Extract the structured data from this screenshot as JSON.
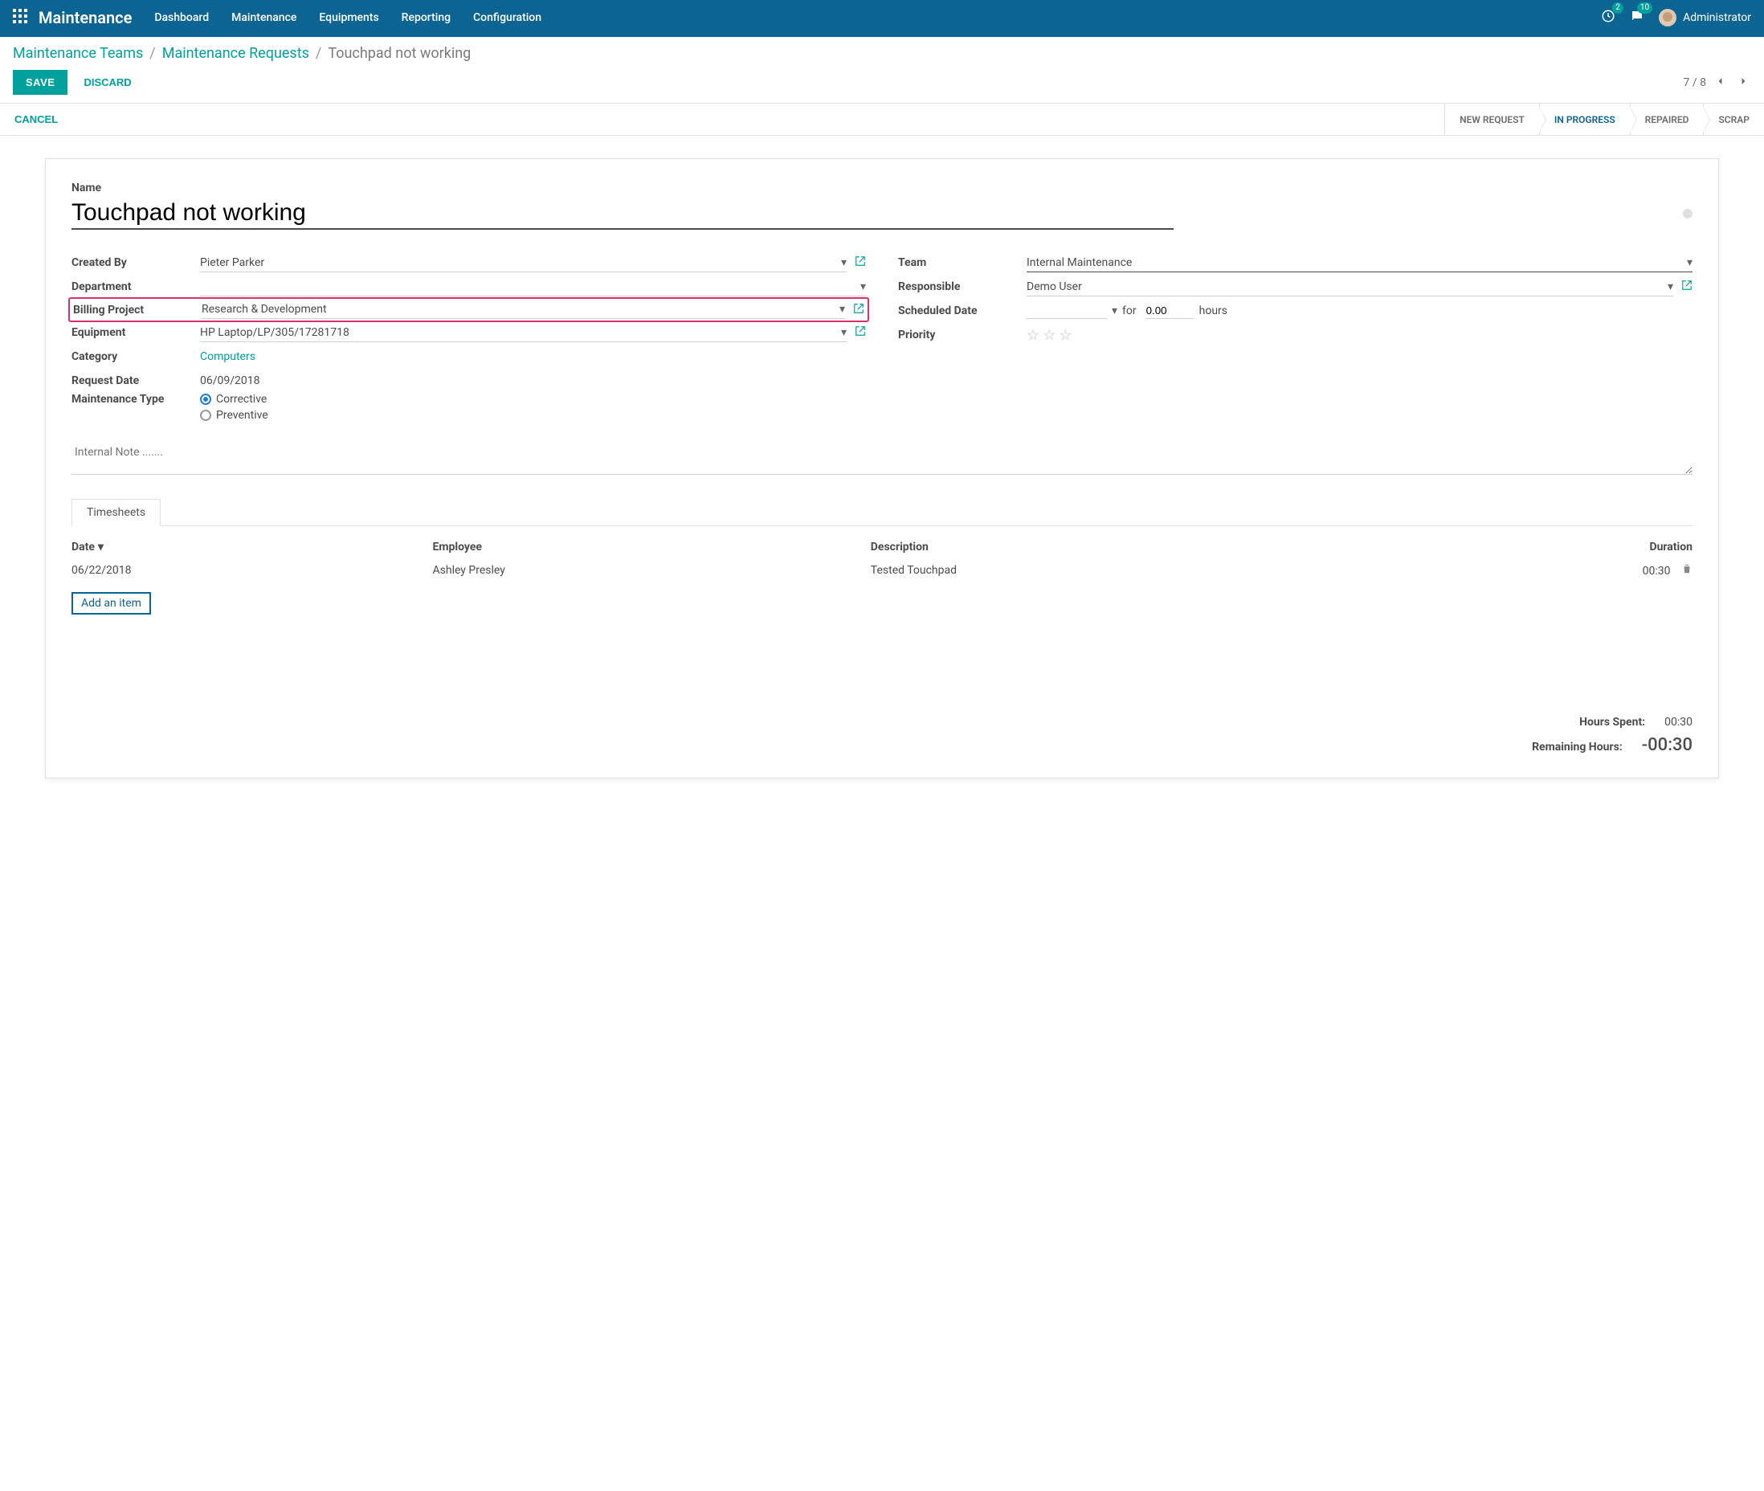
{
  "nav": {
    "brand": "Maintenance",
    "items": [
      "Dashboard",
      "Maintenance",
      "Equipments",
      "Reporting",
      "Configuration"
    ],
    "badge_activities": "2",
    "badge_messages": "10",
    "user_name": "Administrator"
  },
  "breadcrumbs": {
    "a": "Maintenance Teams",
    "b": "Maintenance Requests",
    "c": "Touchpad not working"
  },
  "buttons": {
    "save": "SAVE",
    "discard": "DISCARD",
    "cancel": "CANCEL"
  },
  "pager": {
    "text": "7 / 8"
  },
  "stages": [
    "NEW REQUEST",
    "IN PROGRESS",
    "REPAIRED",
    "SCRAP"
  ],
  "active_stage_index": 1,
  "form": {
    "name_label": "Name",
    "name": "Touchpad not working",
    "labels": {
      "created_by": "Created By",
      "department": "Department",
      "billing_project": "Billing Project",
      "equipment": "Equipment",
      "category": "Category",
      "request_date": "Request Date",
      "maintenance_type": "Maintenance Type",
      "team": "Team",
      "responsible": "Responsible",
      "scheduled_date": "Scheduled Date",
      "priority": "Priority"
    },
    "values": {
      "created_by": "Pieter Parker",
      "department": "",
      "billing_project": "Research & Development",
      "equipment": "HP Laptop/LP/305/17281718",
      "category": "Computers",
      "request_date": "06/09/2018",
      "team": "Internal Maintenance",
      "responsible": "Demo User",
      "scheduled_for": "for",
      "scheduled_hours": "0.00",
      "scheduled_hours_unit": "hours"
    },
    "maintenance_options": {
      "corrective": "Corrective",
      "preventive": "Preventive"
    },
    "note_placeholder": "Internal Note ......."
  },
  "tabs": {
    "timesheets": "Timesheets"
  },
  "timesheets": {
    "cols": {
      "date": "Date",
      "employee": "Employee",
      "description": "Description",
      "duration": "Duration"
    },
    "rows": [
      {
        "date": "06/22/2018",
        "employee": "Ashley Presley",
        "description": "Tested Touchpad",
        "duration": "00:30"
      }
    ],
    "add_item": "Add an item"
  },
  "totals": {
    "hours_spent_label": "Hours Spent:",
    "hours_spent": "00:30",
    "remaining_label": "Remaining Hours:",
    "remaining": "-00:30"
  }
}
